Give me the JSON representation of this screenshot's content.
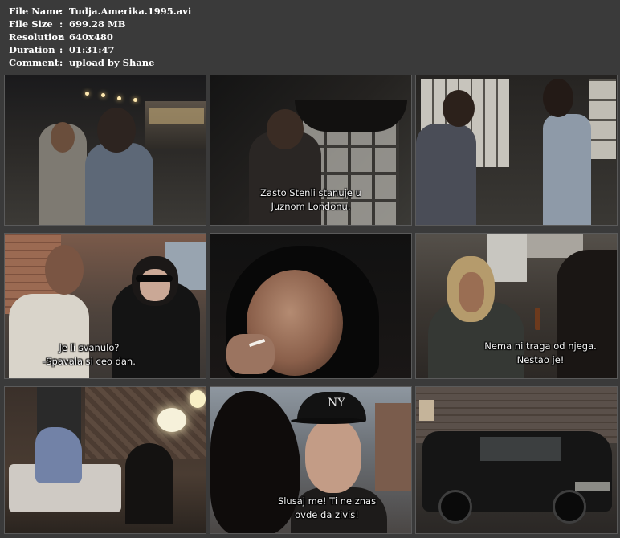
{
  "info": {
    "rows": [
      {
        "key": "File Name",
        "value": "Tudja.Amerika.1995.avi"
      },
      {
        "key": "File Size",
        "value": "699.28 MB"
      },
      {
        "key": "Resolution",
        "value": "640x480"
      },
      {
        "key": "Duration",
        "value": "01:31:47"
      },
      {
        "key": "Comment",
        "value": "upload by Shane"
      }
    ],
    "separator": ":"
  },
  "thumbnails": [
    {
      "subtitle": []
    },
    {
      "subtitle": [
        "Zasto Stenli stanuje u",
        "Juznom Londonu."
      ]
    },
    {
      "subtitle": []
    },
    {
      "subtitle": [
        "Je li svanulo?",
        "-Spavala si ceo dan."
      ]
    },
    {
      "subtitle": []
    },
    {
      "subtitle": [
        "Nema ni traga od njega.",
        "Nestao je!"
      ]
    },
    {
      "subtitle": []
    },
    {
      "subtitle": [
        "Slusaj me! Ti ne znas",
        "ovde da zivis!"
      ],
      "cap_logo": "NY"
    },
    {
      "subtitle": []
    }
  ]
}
